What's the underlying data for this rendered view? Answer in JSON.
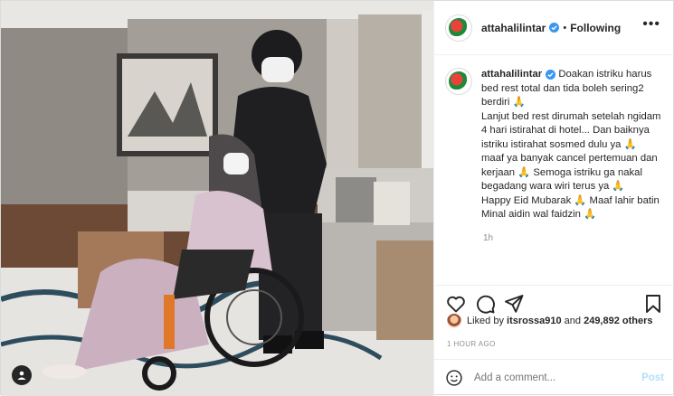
{
  "header": {
    "username": "attahalilintar",
    "separator": "•",
    "follow_status": "Following",
    "more_label": "•••"
  },
  "caption": {
    "username": "attahalilintar",
    "lines": [
      "Doakan istriku harus bed rest total dan tida boleh sering2 berdiri 🙏",
      "Lanjut bed rest dirumah setelah ngidam 4 hari istirahat di hotel... Dan baiknya istriku istirahat sosmed dulu ya 🙏",
      "maaf ya banyak cancel pertemuan dan kerjaan 🙏 Semoga istriku ga nakal begadang wara wiri terus ya 🙏",
      "Happy Eid Mubarak 🙏 Maaf lahir batin Minal aidin wal faidzin 🙏"
    ],
    "time": "1h"
  },
  "likes": {
    "prefix": "Liked by",
    "user": "itsrossa910",
    "and": "and",
    "count": "249,892 others"
  },
  "posted_ago": "1 HOUR AGO",
  "comment_box": {
    "placeholder": "Add a comment...",
    "post_label": "Post"
  },
  "colors": {
    "verified": "#3897f0",
    "post_disabled": "#b2dffc",
    "muted": "#8e8e8e"
  }
}
